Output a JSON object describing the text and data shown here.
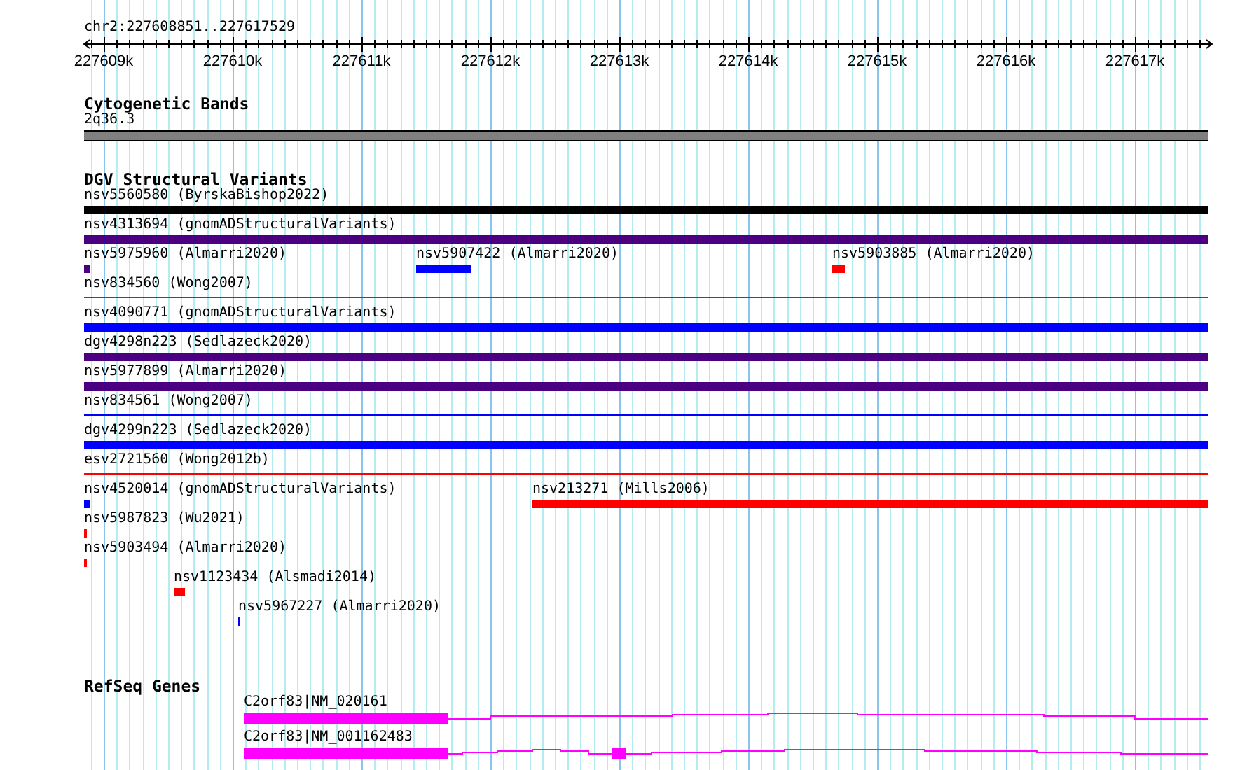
{
  "locus": "chr2:227608851..227617529",
  "ruler": {
    "tick_labels": [
      "227609k",
      "227610k",
      "227611k",
      "227612k",
      "227613k",
      "227614k",
      "227615k",
      "227616k",
      "227617k"
    ]
  },
  "tracks": [
    {
      "kind": "bands",
      "title": "Cytogenetic Bands",
      "features": [
        {
          "label": "2q36.3",
          "color": "#808080"
        }
      ]
    },
    {
      "kind": "variants",
      "title": "DGV Structural Variants",
      "rows": [
        {
          "features": [
            {
              "label": "nsv5560580 (ByrskaBishop2022)",
              "color": "#000000",
              "kind": "bar"
            }
          ]
        },
        {
          "features": [
            {
              "label": "nsv4313694 (gnomADStructuralVariants)",
              "color": "#4b0082",
              "kind": "bar"
            }
          ]
        },
        {
          "features": [
            {
              "label": "nsv5975960 (Almarri2020)",
              "color": "#4b0082",
              "kind": "bar"
            },
            {
              "label": "nsv5907422 (Almarri2020)",
              "color": "#0000ff",
              "kind": "bar"
            },
            {
              "label": "nsv5903885 (Almarri2020)",
              "color": "#ff0000",
              "kind": "bar"
            }
          ]
        },
        {
          "features": [
            {
              "label": "nsv834560 (Wong2007)",
              "color": "#ff0000",
              "kind": "line"
            }
          ]
        },
        {
          "features": [
            {
              "label": "nsv4090771 (gnomADStructuralVariants)",
              "color": "#0000ff",
              "kind": "bar"
            }
          ]
        },
        {
          "features": [
            {
              "label": "dgv4298n223 (Sedlazeck2020)",
              "color": "#4b0082",
              "kind": "bar"
            }
          ]
        },
        {
          "features": [
            {
              "label": "nsv5977899 (Almarri2020)",
              "color": "#4b0082",
              "kind": "bar"
            }
          ]
        },
        {
          "features": [
            {
              "label": "nsv834561 (Wong2007)",
              "color": "#0000ff",
              "kind": "line"
            }
          ]
        },
        {
          "features": [
            {
              "label": "dgv4299n223 (Sedlazeck2020)",
              "color": "#0000ff",
              "kind": "bar"
            }
          ]
        },
        {
          "features": [
            {
              "label": "esv2721560 (Wong2012b)",
              "color": "#ff0000",
              "kind": "line"
            }
          ]
        },
        {
          "features": [
            {
              "label": "nsv4520014 (gnomADStructuralVariants)",
              "color": "#0000ff",
              "kind": "bar"
            },
            {
              "label": "nsv213271 (Mills2006)",
              "color": "#ff0000",
              "kind": "bar"
            }
          ]
        },
        {
          "features": [
            {
              "label": "nsv5987823 (Wu2021)",
              "color": "#ff0000",
              "kind": "bar"
            }
          ]
        },
        {
          "features": [
            {
              "label": "nsv5903494 (Almarri2020)",
              "color": "#ff0000",
              "kind": "bar"
            }
          ]
        },
        {
          "features": [
            {
              "label": "nsv1123434 (Alsmadi2014)",
              "color": "#ff0000",
              "kind": "bar"
            }
          ]
        },
        {
          "features": [
            {
              "label": "nsv5967227 (Almarri2020)",
              "color": "#0000ff",
              "kind": "bar"
            }
          ]
        }
      ]
    },
    {
      "kind": "genes",
      "title": "RefSeq Genes",
      "features": [
        {
          "label": "C2orf83|NM_020161",
          "color": "#ff00ff"
        },
        {
          "label": "C2orf83|NM_001162483",
          "color": "#ff00ff"
        }
      ]
    }
  ]
}
